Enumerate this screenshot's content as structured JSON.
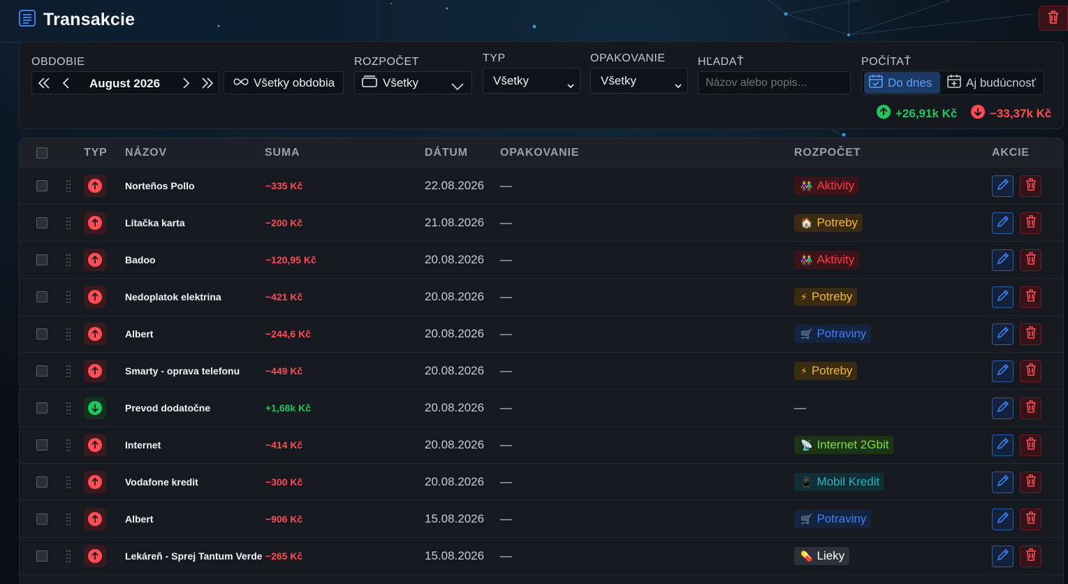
{
  "header": {
    "title": "Transakcie"
  },
  "filters": {
    "period": {
      "label": "OBDOBIE",
      "value": "August 2026",
      "all_periods": "Všetky obdobia"
    },
    "budget": {
      "label": "ROZPOČET",
      "value": "Všetky"
    },
    "type": {
      "label": "TYP",
      "value": "Všetky"
    },
    "recurrence": {
      "label": "OPAKOVANIE",
      "value": "Všetky"
    },
    "search": {
      "label": "HĽADAŤ",
      "placeholder": "Názov alebo popis..."
    },
    "count": {
      "label": "POČÍTAŤ",
      "to_date": "Do dnes",
      "future": "Aj budúcnosť"
    },
    "totals": {
      "income": "+26,91k Kč",
      "expense": "−33,37k Kč"
    }
  },
  "table": {
    "headers": {
      "type": "TYP",
      "name": "NÁZOV",
      "sum": "SUMA",
      "date": "DÁTUM",
      "recurrence": "OPAKOVANIE",
      "budget": "ROZPOČET",
      "actions": "AKCIE"
    },
    "rows": [
      {
        "kind": "out",
        "name": "Norteños Pollo",
        "sum": "−335 Kč",
        "date": "22.08.2026",
        "recurrence": "—",
        "budget": "Aktivity",
        "budget_emoji": "👫",
        "budget_color": "#ff3b47",
        "budget_bg": "#3a1418"
      },
      {
        "kind": "out",
        "name": "Lítačka karta",
        "sum": "−200 Kč",
        "date": "21.08.2026",
        "recurrence": "—",
        "budget": "Potreby",
        "budget_emoji": "🏠",
        "budget_color": "#f4b73c",
        "budget_bg": "#3a2c12"
      },
      {
        "kind": "out",
        "name": "Badoo",
        "sum": "−120,95 Kč",
        "date": "20.08.2026",
        "recurrence": "—",
        "budget": "Aktivity",
        "budget_emoji": "👫",
        "budget_color": "#ff3b47",
        "budget_bg": "#3a1418"
      },
      {
        "kind": "out",
        "name": "Nedoplatok elektrina",
        "sum": "−421 Kč",
        "date": "20.08.2026",
        "recurrence": "—",
        "budget": "Potreby",
        "budget_emoji": "⚡",
        "budget_color": "#f4b73c",
        "budget_bg": "#3a2c12"
      },
      {
        "kind": "out",
        "name": "Albert",
        "sum": "−244,6 Kč",
        "date": "20.08.2026",
        "recurrence": "—",
        "budget": "Potraviny",
        "budget_emoji": "🛒",
        "budget_color": "#3b82f6",
        "budget_bg": "#142440"
      },
      {
        "kind": "out",
        "name": "Smarty - oprava telefonu",
        "sum": "−449 Kč",
        "date": "20.08.2026",
        "recurrence": "—",
        "budget": "Potreby",
        "budget_emoji": "⚡",
        "budget_color": "#f4b73c",
        "budget_bg": "#3a2c12"
      },
      {
        "kind": "in",
        "name": "Prevod dodatočne",
        "sum": "+1,68k Kč",
        "date": "20.08.2026",
        "recurrence": "—",
        "budget": "—",
        "budget_emoji": "",
        "budget_color": "",
        "budget_bg": ""
      },
      {
        "kind": "out",
        "name": "Internet",
        "sum": "−414 Kč",
        "date": "20.08.2026",
        "recurrence": "—",
        "budget": "Internet 2Gbit",
        "budget_emoji": "📡",
        "budget_color": "#7ee03a",
        "budget_bg": "#1d3417"
      },
      {
        "kind": "out",
        "name": "Vodafone kredit",
        "sum": "−300 Kč",
        "date": "20.08.2026",
        "recurrence": "—",
        "budget": "Mobil Kredit",
        "budget_emoji": "📱",
        "budget_color": "#2bb3c6",
        "budget_bg": "#102e34"
      },
      {
        "kind": "out",
        "name": "Albert",
        "sum": "−906 Kč",
        "date": "15.08.2026",
        "recurrence": "—",
        "budget": "Potraviny",
        "budget_emoji": "🛒",
        "budget_color": "#3b82f6",
        "budget_bg": "#142440"
      },
      {
        "kind": "out",
        "name": "Lekáreň - Sprej Tantum Verde",
        "sum": "−265 Kč",
        "date": "15.08.2026",
        "recurrence": "—",
        "budget": "Lieky",
        "budget_emoji": "💊",
        "budget_color": "#ffffff",
        "budget_bg": "#2e3138"
      }
    ]
  },
  "colors": {
    "accent_blue": "#3b82f6",
    "danger": "#ff4d56",
    "success": "#22c55e"
  }
}
